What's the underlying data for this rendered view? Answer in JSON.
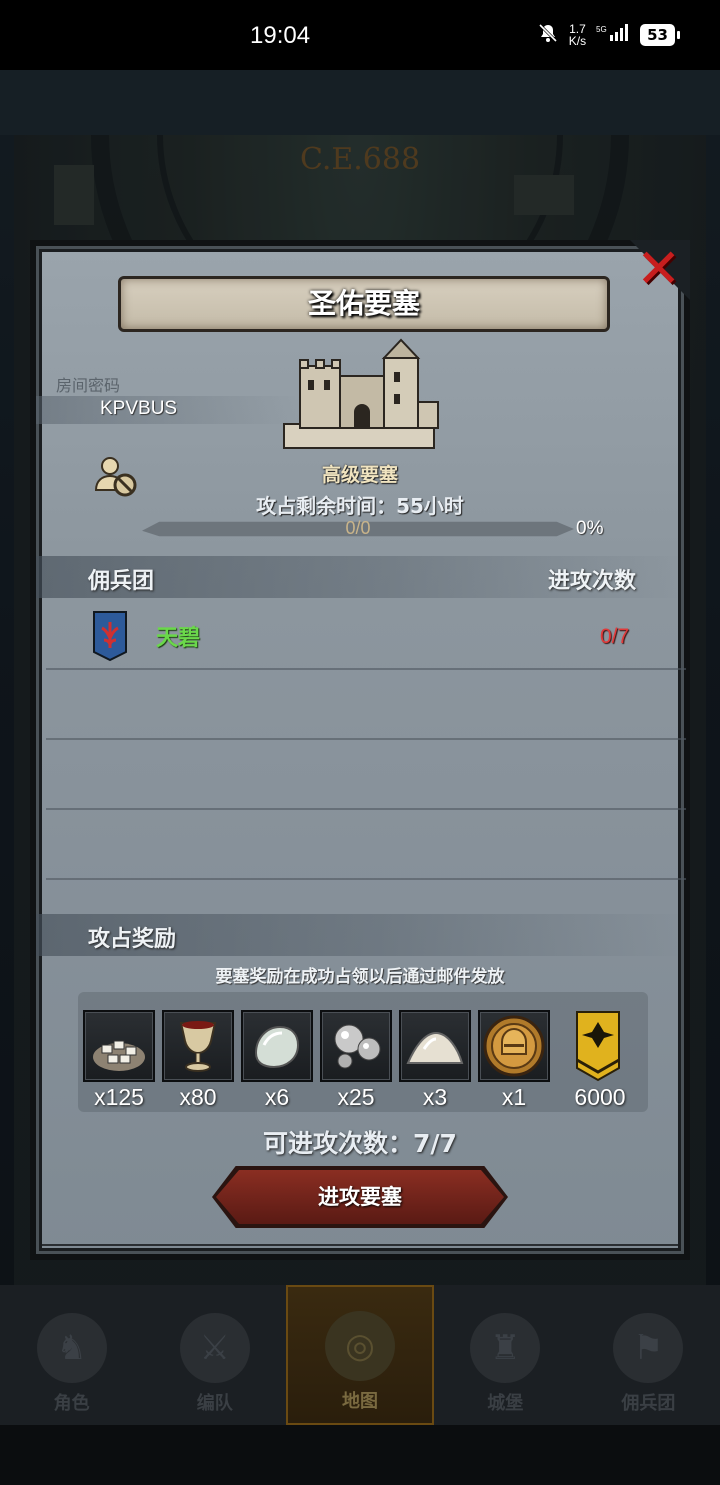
{
  "status_bar": {
    "time": "19:04",
    "speed_top": "1.7",
    "speed_bottom": "K/s",
    "network": "5G",
    "battery": "53"
  },
  "background": {
    "era": "C.E.688"
  },
  "dialog": {
    "title": "圣佑要塞",
    "room_code_label": "房间密码",
    "room_code": "KPVBUS",
    "fort_level": "高级要塞",
    "remaining_time": "攻占剩余时间：55小时",
    "progress": {
      "current": 0,
      "total": 0,
      "count_text": "0/0",
      "percent_text": "0%"
    },
    "mercenary_header": "佣兵团",
    "attack_count_header": "进攻次数",
    "guilds": [
      {
        "name": "天碧",
        "attacks": "0/7",
        "name_color": "#6ad84a",
        "attacks_color": "#e13a3a"
      }
    ],
    "reward_header": "攻占奖励",
    "reward_note": "要塞奖励在成功占领以后通过邮件发放",
    "rewards": [
      {
        "icon": "silver-pile-icon",
        "qty": "x125"
      },
      {
        "icon": "goblet-icon",
        "qty": "x80"
      },
      {
        "icon": "stone-icon",
        "qty": "x6"
      },
      {
        "icon": "pearls-icon",
        "qty": "x25"
      },
      {
        "icon": "powder-pile-icon",
        "qty": "x3"
      },
      {
        "icon": "knight-helmet-icon",
        "qty": "x1"
      },
      {
        "icon": "guild-emblem-icon",
        "qty": "6000"
      }
    ],
    "attempts": "可进攻次数：7/7",
    "attack_button": "进攻要塞"
  },
  "bottom_nav": [
    {
      "label": "角色",
      "icon": "character-icon",
      "active": false
    },
    {
      "label": "编队",
      "icon": "formation-icon",
      "active": false
    },
    {
      "label": "地图",
      "icon": "map-icon",
      "active": true
    },
    {
      "label": "城堡",
      "icon": "castle-icon",
      "active": false
    },
    {
      "label": "佣兵团",
      "icon": "mercenary-icon",
      "active": false
    }
  ],
  "colors": {
    "accent_gold": "#d5a93a",
    "close_red": "#c81e1e",
    "button_red": "#8a2e22"
  }
}
